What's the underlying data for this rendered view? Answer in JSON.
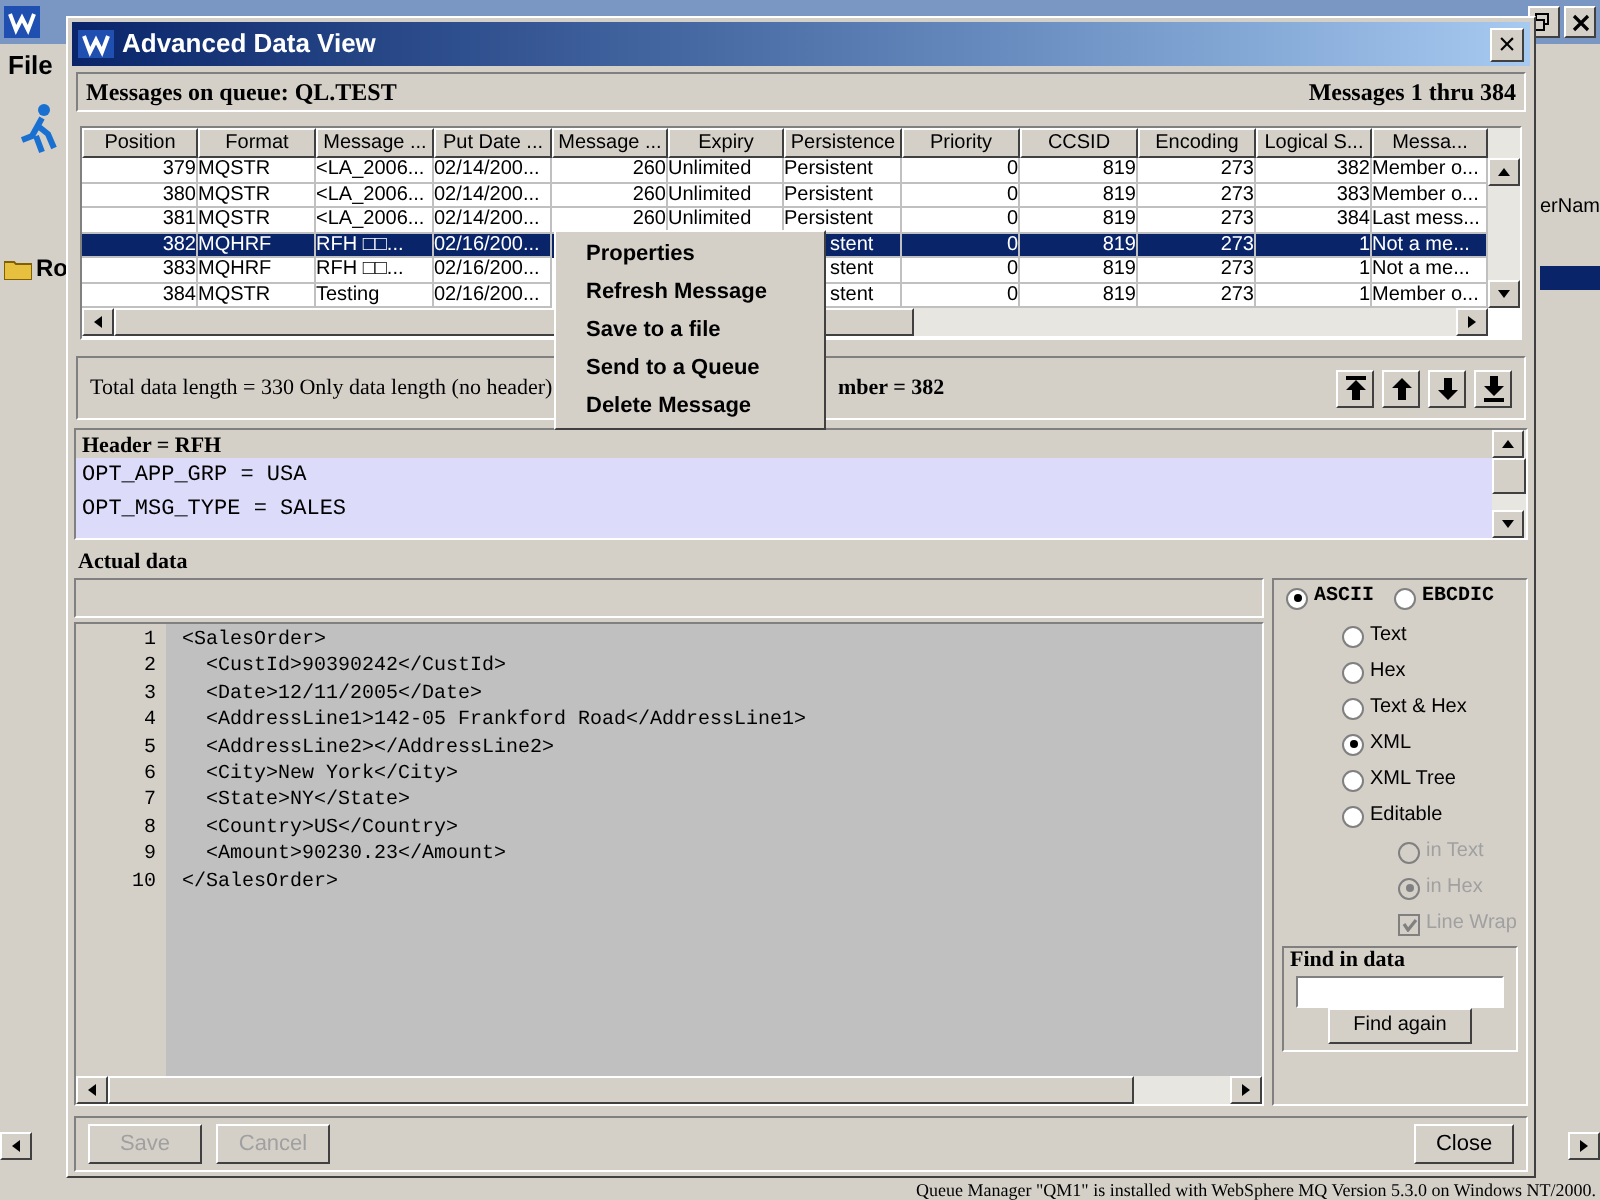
{
  "app": {
    "menu": [
      "File"
    ],
    "tree_root": "Ro",
    "column_header": "erNam",
    "status": "Queue Manager \"QM1\" is installed with WebSphere MQ Version 5.3.0 on Windows NT/2000."
  },
  "dialog": {
    "title": "Advanced Data View",
    "close": "×",
    "queue_label": "Messages on queue: QL.TEST",
    "range_label": "Messages 1 thru 384",
    "table": {
      "columns": [
        "Position",
        "Format",
        "Message ...",
        "Put Date ...",
        "Message ...",
        "Expiry",
        "Persistence",
        "Priority",
        "CCSID",
        "Encoding",
        "Logical S...",
        "Messa..."
      ],
      "rows": [
        {
          "selected": false,
          "covered": false,
          "cells": [
            "379",
            "MQSTR",
            "<LA_2006...",
            "02/14/200...",
            "260",
            "Unlimited",
            "Persistent",
            "0",
            "819",
            "273",
            "382",
            "Member o..."
          ]
        },
        {
          "selected": false,
          "covered": false,
          "cells": [
            "380",
            "MQSTR",
            "<LA_2006...",
            "02/14/200...",
            "260",
            "Unlimited",
            "Persistent",
            "0",
            "819",
            "273",
            "383",
            "Member o..."
          ]
        },
        {
          "selected": false,
          "covered": false,
          "cells": [
            "381",
            "MQSTR",
            "<LA_2006...",
            "02/14/200...",
            "260",
            "Unlimited",
            "Persistent",
            "0",
            "819",
            "273",
            "384",
            "Last mess..."
          ]
        },
        {
          "selected": true,
          "covered": true,
          "cells": [
            "382",
            "MQHRF",
            "RFH □□...",
            "02/16/200...",
            "stent",
            "0",
            "819",
            "273",
            "1",
            "Not a me..."
          ]
        },
        {
          "selected": false,
          "covered": true,
          "cells": [
            "383",
            "MQHRF",
            "RFH □□...",
            "02/16/200...",
            "stent",
            "0",
            "819",
            "273",
            "1",
            "Not a me..."
          ]
        },
        {
          "selected": false,
          "covered": true,
          "cells": [
            "384",
            "MQSTR",
            "Testing",
            "02/16/200...",
            "stent",
            "0",
            "819",
            "273",
            "1",
            "Member o..."
          ]
        }
      ]
    },
    "context_menu": [
      "Properties",
      "Refresh Message",
      "Save to a file",
      "Send to a Queue",
      "Delete Message"
    ],
    "summary_left": "Total data length = 330  Only data length (no header)",
    "summary_right": "mber = 382",
    "header_title": "Header = RFH",
    "header_lines": [
      "OPT_APP_GRP = USA",
      "OPT_MSG_TYPE = SALES"
    ],
    "actual_data_label": "Actual data",
    "code_lines": [
      {
        "number": "1",
        "text": "<SalesOrder>"
      },
      {
        "number": "2",
        "text": "  <CustId>90390242</CustId>"
      },
      {
        "number": "3",
        "text": "  <Date>12/11/2005</Date>"
      },
      {
        "number": "4",
        "text": "  <AddressLine1>142-05 Frankford Road</AddressLine1>"
      },
      {
        "number": "5",
        "text": "  <AddressLine2></AddressLine2>"
      },
      {
        "number": "6",
        "text": "  <City>New York</City>"
      },
      {
        "number": "7",
        "text": "  <State>NY</State>"
      },
      {
        "number": "8",
        "text": "  <Country>US</Country>"
      },
      {
        "number": "9",
        "text": "  <Amount>90230.23</Amount>"
      },
      {
        "number": "10",
        "text": "</SalesOrder>"
      }
    ],
    "encodings": [
      {
        "label": "ASCII",
        "selected": true
      },
      {
        "label": "EBCDIC",
        "selected": false
      }
    ],
    "formats": [
      {
        "label": "Text",
        "selected": false
      },
      {
        "label": "Hex",
        "selected": false
      },
      {
        "label": "Text & Hex",
        "selected": false
      },
      {
        "label": "XML",
        "selected": true
      },
      {
        "label": "XML Tree",
        "selected": false
      },
      {
        "label": "Editable",
        "selected": false
      }
    ],
    "edit_modes": [
      {
        "label": "in Text",
        "selected": false,
        "disabled": true
      },
      {
        "label": "in Hex",
        "selected": true,
        "disabled": true
      }
    ],
    "line_wrap": {
      "label": "Line Wrap",
      "checked": true,
      "disabled": true
    },
    "find": {
      "title": "Find in data",
      "button": "Find again"
    },
    "buttons": [
      {
        "label": "Save",
        "disabled": true
      },
      {
        "label": "Cancel",
        "disabled": true
      },
      {
        "label": "Close",
        "disabled": false
      }
    ]
  }
}
